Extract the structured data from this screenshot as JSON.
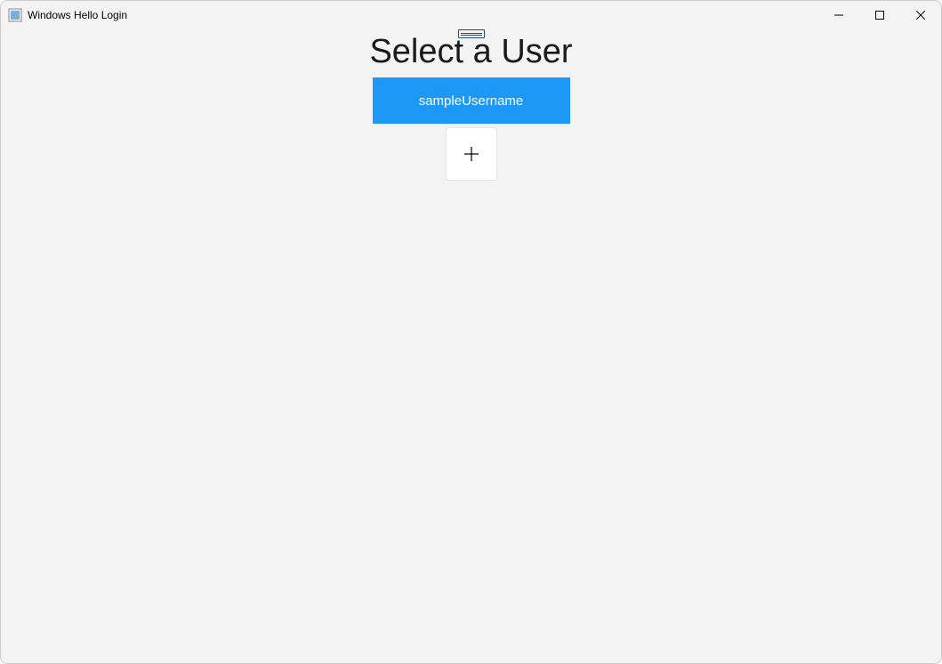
{
  "window": {
    "title": "Windows Hello Login"
  },
  "main": {
    "heading": "Select a User",
    "users": [
      {
        "name": "sampleUsername"
      }
    ],
    "add_label": "+"
  }
}
